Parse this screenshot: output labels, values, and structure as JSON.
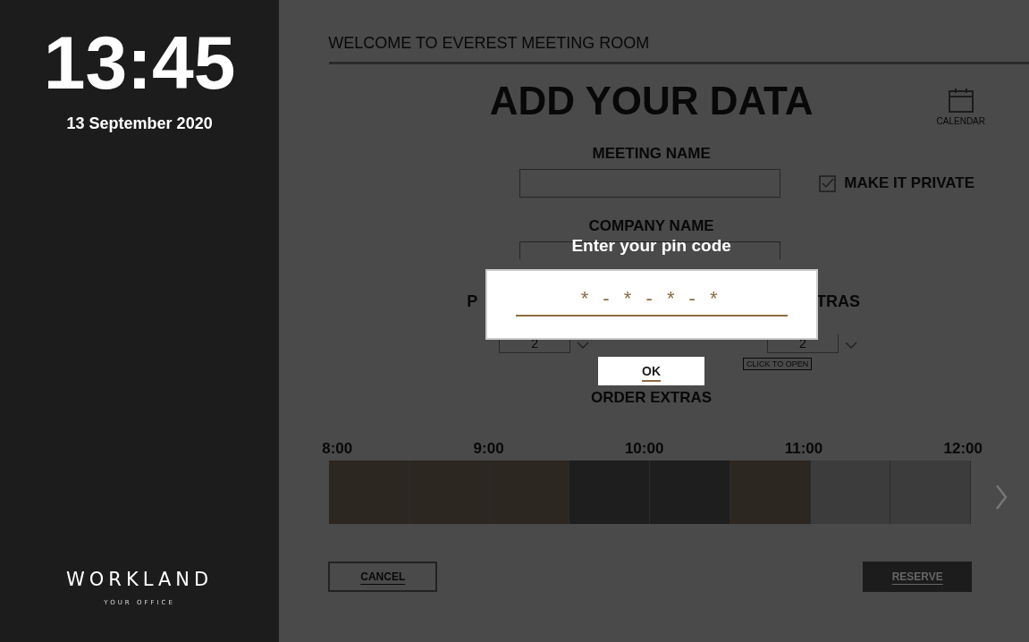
{
  "clock": {
    "time": "13:45",
    "date": "13 September 2020"
  },
  "brand": {
    "name": "WORKLAND",
    "tagline": "YOUR OFFICE"
  },
  "header": {
    "title": "WELCOME TO EVEREST MEETING ROOM"
  },
  "form": {
    "title": "ADD YOUR DATA",
    "calendar_label": "CALENDAR",
    "meeting_name_label": "MEETING NAME",
    "private": {
      "label": "MAKE IT PRIVATE",
      "checked": true
    },
    "company_name_label": "COMPANY NAME",
    "left_label": "P",
    "left_value": "2",
    "right_label": "TRAS",
    "right_value": "2",
    "click_to_open": "CLICK TO OPEN",
    "order_extras": "ORDER EXTRAS"
  },
  "timeline": {
    "hours": [
      "8:00",
      "9:00",
      "10:00",
      "11:00",
      "12:00"
    ],
    "slots": [
      {
        "kind": "mine"
      },
      {
        "kind": "mine"
      },
      {
        "kind": "mine"
      },
      {
        "kind": "booked"
      },
      {
        "kind": "booked"
      },
      {
        "kind": "mine"
      },
      {
        "kind": "free"
      },
      {
        "kind": "free"
      }
    ]
  },
  "buttons": {
    "cancel": "CANCEL",
    "reserve": "RESERVE"
  },
  "pin_dialog": {
    "title": "Enter your pin code",
    "value": "* - * - * - *",
    "ok": "OK"
  }
}
